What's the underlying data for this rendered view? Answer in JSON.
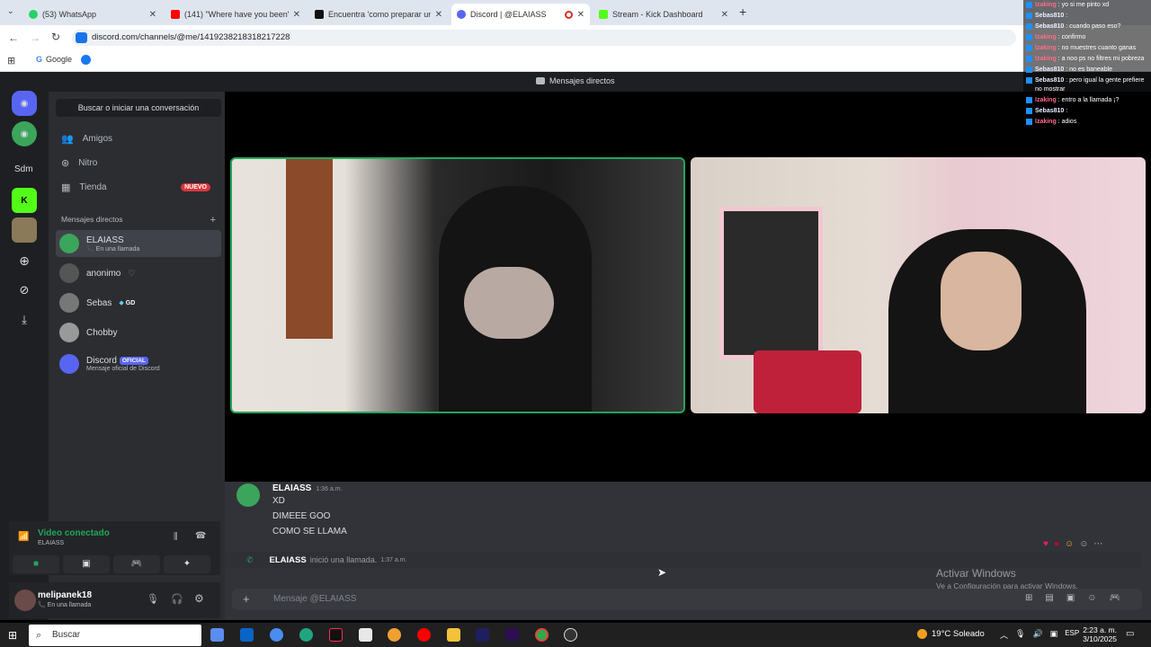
{
  "browser": {
    "tabs": [
      {
        "label": "(53) WhatsApp",
        "color": "#25d366"
      },
      {
        "label": "(141) \"Where have you been\" -",
        "color": "#ff0000"
      },
      {
        "label": "Encuentra 'como preparar un c",
        "color": "#111111"
      },
      {
        "label": "Discord | @ELAIASS",
        "color": "#5865f2"
      },
      {
        "label": "Stream - Kick Dashboard",
        "color": "#53fc18"
      }
    ],
    "url": "discord.com/channels/@me/1419238218318217228",
    "bookmarks": [
      "Google"
    ]
  },
  "discord": {
    "header_title": "Mensajes directos",
    "guild_label": "Sdm",
    "search_label": "Buscar o iniciar una conversación",
    "nav": [
      {
        "label": "Amigos",
        "icon": "friends-icon"
      },
      {
        "label": "Nitro",
        "icon": "nitro-icon"
      },
      {
        "label": "Tienda",
        "icon": "shop-icon",
        "badge": "NUEVO"
      }
    ],
    "dm_header": "Mensajes directos",
    "dms": [
      {
        "name": "ELAIASS",
        "sub": "En una llamada",
        "color": "#3ba55c"
      },
      {
        "name": "anonimo",
        "sub": "",
        "color": "#555"
      },
      {
        "name": "Sebas",
        "sub": "",
        "tag": "GD",
        "color": "#777"
      },
      {
        "name": "Chobby",
        "sub": "",
        "color": "#888"
      },
      {
        "name": "Discord",
        "sub": "Mensaje oficial de Discord",
        "tag": "OFICIAL",
        "color": "#5865f2"
      }
    ],
    "voice": {
      "status": "Video conectado",
      "channel": "ELAIASS"
    },
    "user": {
      "name": "melipanek18",
      "status": "En una llamada"
    },
    "messages": [
      {
        "author": "ELAIASS",
        "time": "1:36 a.m.",
        "lines": [
          "XD",
          "DIMEEE GOO",
          "COMO SE LLAMA"
        ]
      }
    ],
    "system_msg": {
      "author": "ELAIASS",
      "text": "inició una llamada.",
      "time": "1:37 a.m."
    },
    "input_placeholder": "Mensaje @ELAIASS"
  },
  "watermark": {
    "title": "Activar Windows",
    "sub": "Ve a Configuración para activar Windows."
  },
  "kick_chat": [
    {
      "user": "Izaking",
      "msg": "yo si me pinto xd"
    },
    {
      "user": "Sebas810",
      "msg": ""
    },
    {
      "user": "Sebas810",
      "msg": "cuando paso eso?"
    },
    {
      "user": "Izaking",
      "msg": "confirmo"
    },
    {
      "user": "Izaking",
      "msg": "no muestres cuanto ganas"
    },
    {
      "user": "Izaking",
      "msg": "a noo ps no filtres mi pobreza"
    },
    {
      "user": "Sebas810",
      "msg": "no es baneable"
    },
    {
      "user": "Sebas810",
      "msg": "pero igual la gente prefiere no mostrar"
    },
    {
      "user": "Izaking",
      "msg": "entro a la llamada ¡?"
    },
    {
      "user": "Sebas810",
      "msg": ""
    },
    {
      "user": "Izaking",
      "msg": "adios"
    }
  ],
  "taskbar": {
    "search_label": "Buscar",
    "weather": "19°C Soleado",
    "lang": "ESP",
    "time": "2:23 a. m.",
    "date": "3/10/2025"
  }
}
